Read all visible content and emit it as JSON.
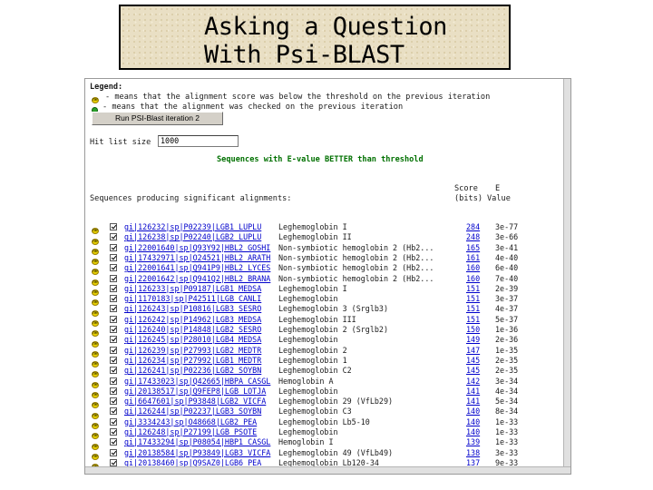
{
  "slide": {
    "title_line1": "Asking a Question",
    "title_line2": "With Psi-BLAST"
  },
  "legend": {
    "heading": "Legend:",
    "item1": "- means that the alignment score was below the threshold on the previous iteration",
    "item2": "- means that the alignment was checked on the previous iteration"
  },
  "run_button": "Run PSI-Blast iteration 2",
  "hit_list": {
    "label": "Hit list size",
    "value": "1000"
  },
  "sequences_header": "Sequences with E-value BETTER than threshold",
  "columns": {
    "producing": "Sequences producing significant alignments:",
    "score_top": "Score",
    "score_bottom": "(bits)",
    "evalue_top": "E",
    "evalue_bottom": "Value"
  },
  "icons": {
    "new": "new-sequence-icon",
    "checked": "checked-dot-icon",
    "checkbox": "checkbox-checked"
  },
  "rows": [
    {
      "id": "gi|126232|sp|P02239|LGB1_LUPLU",
      "desc": "Leghemoglobin I",
      "score": "284",
      "evalue": "3e-77"
    },
    {
      "id": "gi|126238|sp|P02240|LGB2_LUPLU",
      "desc": "Leghemoglobin II",
      "score": "248",
      "evalue": "3e-66"
    },
    {
      "id": "gi|22001640|sp|Q93Y92|HBL2_GOSHI",
      "desc": "Non-symbiotic hemoglobin 2 (Hb2...",
      "score": "165",
      "evalue": "3e-41"
    },
    {
      "id": "gi|17432971|sp|O24521|HBL2_ARATH",
      "desc": "Non-symbiotic hemoglobin 2 (Hb2...",
      "score": "161",
      "evalue": "4e-40"
    },
    {
      "id": "gi|22001641|sp|Q941P9|HBL2_LYCES",
      "desc": "Non-symbiotic hemoglobin 2 (Hb2...",
      "score": "160",
      "evalue": "6e-40"
    },
    {
      "id": "gi|22001642|sp|Q941Q2|HBL2_BRANA",
      "desc": "Non-symbiotic hemoglobin 2 (Hb2...",
      "score": "160",
      "evalue": "7e-40"
    },
    {
      "id": "gi|126233|sp|P09187|LGB1_MEDSA",
      "desc": "Leghemoglobin I",
      "score": "151",
      "evalue": "2e-39"
    },
    {
      "id": "gi|1170183|sp|P42511|LGB_CANLI",
      "desc": "Leghemoglobin",
      "score": "151",
      "evalue": "3e-37"
    },
    {
      "id": "gi|126243|sp|P10816|LGB3_SESRO",
      "desc": "Leghemoglobin 3 (Srglb3)",
      "score": "151",
      "evalue": "4e-37"
    },
    {
      "id": "gi|126242|sp|P14962|LGB3_MEDSA",
      "desc": "Leghemoglobin III",
      "score": "151",
      "evalue": "5e-37"
    },
    {
      "id": "gi|126240|sp|P14848|LGB2_SESRO",
      "desc": "Leghemoglobin 2 (Srglb2)",
      "score": "150",
      "evalue": "1e-36"
    },
    {
      "id": "gi|126245|sp|P28010|LGB4_MEDSA",
      "desc": "Leghemoglobin",
      "score": "149",
      "evalue": "2e-36"
    },
    {
      "id": "gi|126239|sp|P27993|LGB2_MEDTR",
      "desc": "Leghemoglobin 2",
      "score": "147",
      "evalue": "1e-35"
    },
    {
      "id": "gi|126234|sp|P27992|LGB1_MEDTR",
      "desc": "Leghemoglobin 1",
      "score": "145",
      "evalue": "2e-35"
    },
    {
      "id": "gi|126241|sp|P02236|LGB2_SOYBN",
      "desc": "Leghemoglobin C2",
      "score": "145",
      "evalue": "2e-35"
    },
    {
      "id": "gi|17433023|sp|Q42665|HBPA_CASGL",
      "desc": "Hemoglobin A",
      "score": "142",
      "evalue": "3e-34"
    },
    {
      "id": "gi|20138517|sp|Q9FEP8|LGB_LOTJA",
      "desc": "Leghemoglobin",
      "score": "141",
      "evalue": "4e-34"
    },
    {
      "id": "gi|6647601|sp|P93848|LGB2_VICFA",
      "desc": "Leghemoglobin 29 (VfLb29)",
      "score": "141",
      "evalue": "5e-34"
    },
    {
      "id": "gi|126244|sp|P02237|LGB3_SOYBN",
      "desc": "Leghemoglobin C3",
      "score": "140",
      "evalue": "8e-34"
    },
    {
      "id": "gi|3334243|sp|O48668|LGB2_PEA",
      "desc": "Leghemoglobin Lb5-10",
      "score": "140",
      "evalue": "1e-33"
    },
    {
      "id": "gi|126248|sp|P27199|LGB_PSOTE",
      "desc": "Leghemoglobin",
      "score": "140",
      "evalue": "1e-33"
    },
    {
      "id": "gi|17433294|sp|P08054|HBP1_CASGL",
      "desc": "Hemoglobin I",
      "score": "139",
      "evalue": "1e-33"
    },
    {
      "id": "gi|20138584|sp|P93849|LGB3_VICFA",
      "desc": "Leghemoglobin 49 (VfLb49)",
      "score": "138",
      "evalue": "3e-33"
    },
    {
      "id": "gi|20138460|sp|Q9SAZ0|LGB6_PEA",
      "desc": "Leghemoglobin Lb120-34",
      "score": "137",
      "evalue": "9e-33"
    }
  ]
}
